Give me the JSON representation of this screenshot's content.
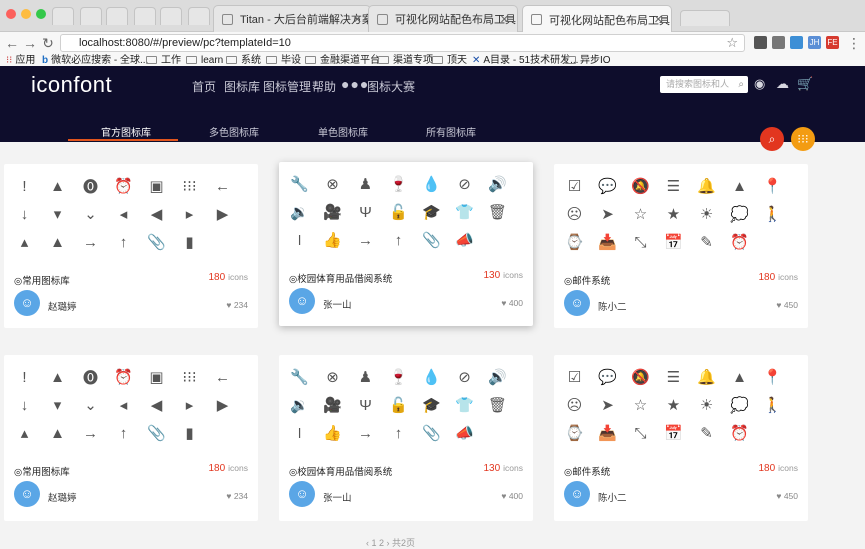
{
  "browser": {
    "tabs": [
      {
        "title": "Titan - 大后台前端解决方案",
        "active": false
      },
      {
        "title": "可视化网站配色布局工具",
        "active": false
      },
      {
        "title": "可视化网站配色布局工具",
        "active": true
      }
    ],
    "url": "localhost:8080/#/preview/pc?templateId=10",
    "extensions": [
      "JH",
      "FE"
    ],
    "bookmarks": [
      "应用",
      "微软必应搜索 - 全球...",
      "工作",
      "learn",
      "系统",
      "毕设",
      "金融渠道平台",
      "渠道专项",
      "顶天",
      "A目录 - 51技术研发...",
      "异步IO"
    ]
  },
  "header": {
    "logo": "iconfont",
    "nav": [
      "首页",
      "图标库",
      "图标管理",
      "帮助",
      "●●●",
      "图标大赛"
    ],
    "search_placeholder": "请搜索图标和人",
    "subnav": [
      "官方图标库",
      "多色图标库",
      "单色图标库",
      "所有图标库"
    ],
    "active_subnav": "官方图标库"
  },
  "fab": {
    "search_color": "#e2361f",
    "grid_color": "#f39c12"
  },
  "accent_color": "#e2551d",
  "cards": [
    {
      "title": "◎常用图标库",
      "count": "180",
      "unit": "icons",
      "author": "赵璐婷",
      "likes": "♥ 234",
      "icon_set": 0
    },
    {
      "title": "◎校园体育用品借阅系统",
      "count": "130",
      "unit": "icons",
      "author": "张一山",
      "likes": "♥ 400",
      "icon_set": 1
    },
    {
      "title": "◎邮件系统",
      "count": "180",
      "unit": "icons",
      "author": "陈小二",
      "likes": "♥ 450",
      "icon_set": 2
    },
    {
      "title": "◎常用图标库",
      "count": "180",
      "unit": "icons",
      "author": "赵璐婷",
      "likes": "♥ 234",
      "icon_set": 0
    },
    {
      "title": "◎校园体育用品借阅系统",
      "count": "130",
      "unit": "icons",
      "author": "张一山",
      "likes": "♥ 400",
      "icon_set": 1
    },
    {
      "title": "◎邮件系统",
      "count": "180",
      "unit": "icons",
      "author": "陈小二",
      "likes": "♥ 450",
      "icon_set": 2
    }
  ],
  "icon_sets": [
    [
      "!",
      "▲",
      "⓿",
      "⏰",
      "▣",
      "⁝⁝⁝",
      "←",
      "↓",
      "▾",
      "⌄",
      "◂",
      "◀",
      "▸",
      "▶",
      "▴",
      "▲",
      "→",
      "↑",
      "📎",
      "▮"
    ],
    [
      "🔧",
      "⊗",
      "♟",
      "🍷",
      "💧",
      "⊘",
      "🔊",
      "🔉",
      "🎥",
      "Ψ",
      "🔓",
      "🎓",
      "👕",
      "🗑",
      "⏽",
      "👍",
      "→",
      "↑",
      "📎",
      "📣"
    ],
    [
      "☑",
      "💬",
      "🔕",
      "☰",
      "🔔",
      "▲",
      "📍",
      "☹",
      "➤",
      "☆",
      "★",
      "☀",
      "💭",
      "🚶",
      "⌚",
      "📥",
      "⤡",
      "📅",
      "✎",
      "⏰"
    ]
  ],
  "pager": "‹  1  2  ›   共2页"
}
